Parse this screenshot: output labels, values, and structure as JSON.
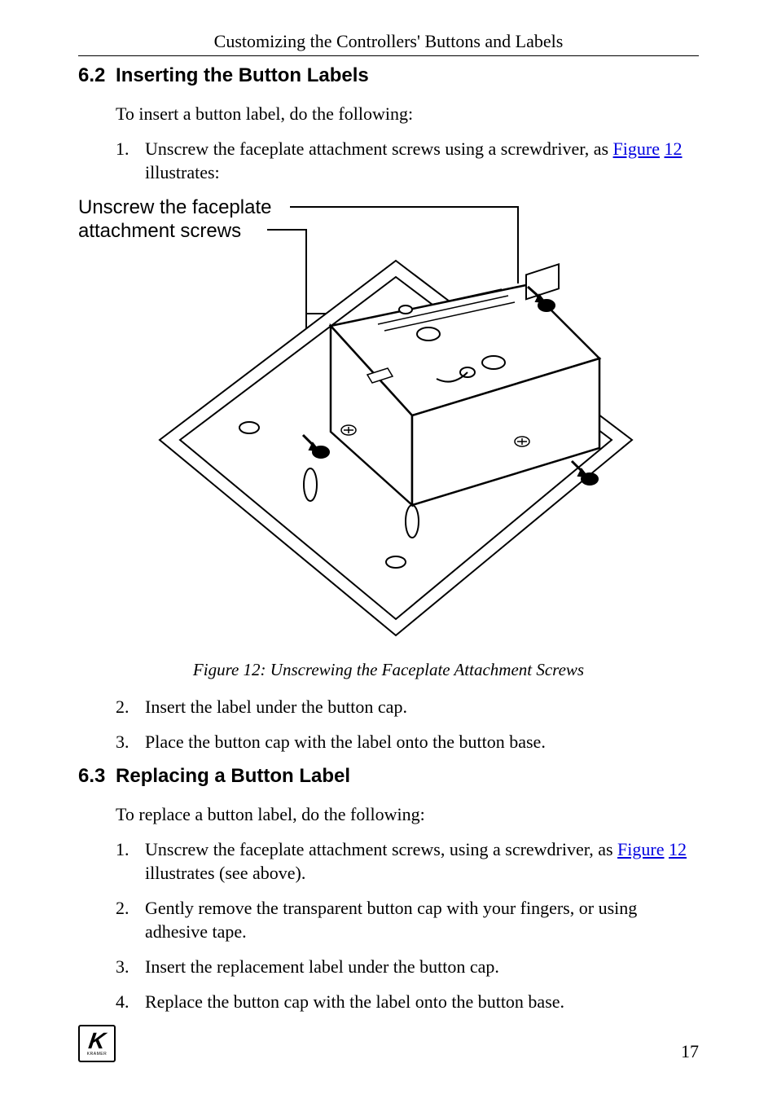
{
  "header": {
    "running": "Customizing the Controllers' Buttons and Labels"
  },
  "s62": {
    "num": "6.2",
    "title": "Inserting the Button Labels",
    "intro": "To insert a button label, do the following:",
    "steps": [
      {
        "n": "1.",
        "pre": "Unscrew the faceplate attachment screws using a screwdriver, as ",
        "link1": "Figure",
        "mid": " ",
        "link2": "12",
        "post": " illustrates:"
      },
      {
        "n": "2.",
        "text": "Insert the label under the button cap."
      },
      {
        "n": "3.",
        "text": "Place the button cap with the label onto the button base."
      }
    ]
  },
  "figure": {
    "annot_l1": "Unscrew the faceplate",
    "annot_l2": "attachment screws",
    "caption": "Figure 12: Unscrewing the Faceplate Attachment Screws"
  },
  "s63": {
    "num": "6.3",
    "title": "Replacing a Button Label",
    "intro": "To replace a button label, do the following:",
    "steps": [
      {
        "n": "1.",
        "pre": "Unscrew the faceplate attachment screws, using a screwdriver, as ",
        "link1": "Figure",
        "mid": " ",
        "link2": "12",
        "post": " illustrates (see above)."
      },
      {
        "n": "2.",
        "text": "Gently remove the transparent button cap with your fingers, or using adhesive tape."
      },
      {
        "n": "3.",
        "text": "Insert the replacement label under the button cap."
      },
      {
        "n": "4.",
        "text": "Replace the button cap with the label onto the button base."
      }
    ]
  },
  "footer": {
    "page": "17",
    "brand": "KRAMER"
  }
}
